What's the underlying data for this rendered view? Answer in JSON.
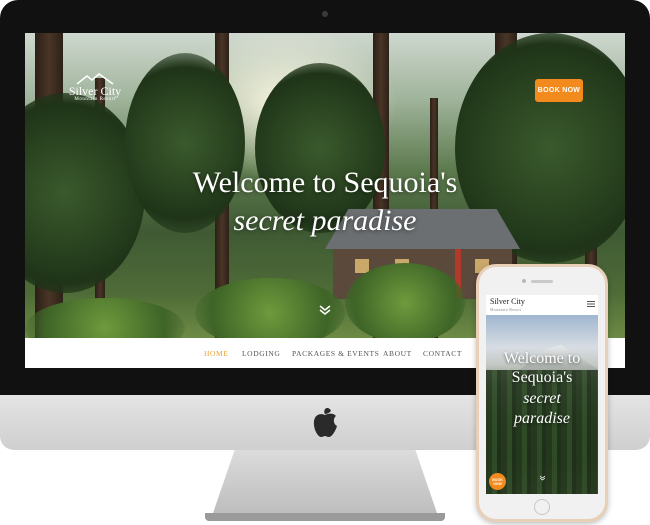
{
  "site": {
    "logo": {
      "name": "Silver City",
      "tagline": "Mountain Resort"
    },
    "book_now_label": "BOOK NOW",
    "hero": {
      "line1": "Welcome to Sequoia's",
      "line2": "secret paradise"
    },
    "nav": [
      {
        "label": "HOME",
        "active": true
      },
      {
        "label": "LODGING",
        "active": false
      },
      {
        "label": "PACKAGES & EVENTS",
        "active": false
      },
      {
        "label": "ABOUT",
        "active": false
      },
      {
        "label": "CONTACT",
        "active": false
      }
    ]
  },
  "mobile": {
    "logo": {
      "name": "Silver City",
      "tagline": "Mountain Resort"
    },
    "hero": {
      "line1": "Welcome to",
      "line2": "Sequoia's",
      "line3": "secret",
      "line4": "paradise"
    },
    "book_now_line1": "BOOK",
    "book_now_line2": "NOW"
  },
  "icons": {
    "apple": "apple-logo-icon",
    "scroll": "chevron-down-icon",
    "menu": "hamburger-menu-icon",
    "logo_mark": "mountain-icon"
  },
  "colors": {
    "accent": "#f28a1e",
    "nav_active": "#e8a23a",
    "nav_text": "#555555"
  }
}
